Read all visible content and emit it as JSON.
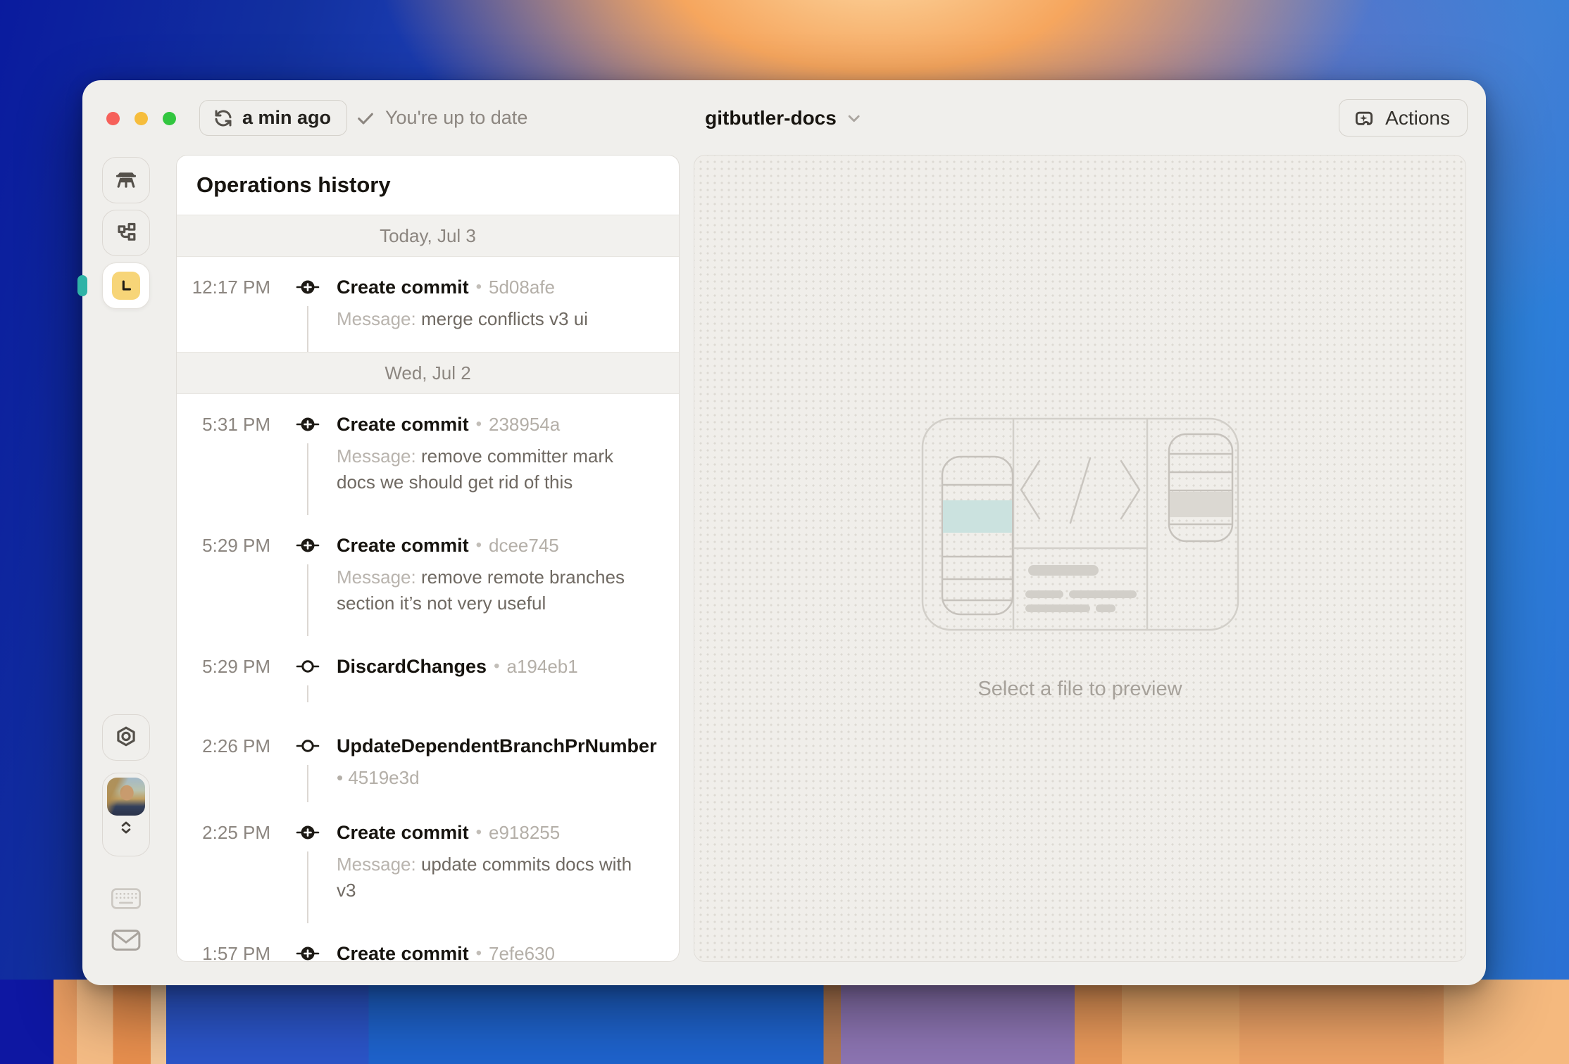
{
  "colors": {
    "accent_teal": "#2fb3a7",
    "lane_yellow": "#f7d578",
    "window_bg": "#f0efec",
    "panel_bg": "#ffffff",
    "section_bg": "#f2f1ee",
    "text_primary": "#17140f",
    "text_secondary": "#8c8680",
    "text_muted": "#b4afa8",
    "illustration_highlight_teal": "#cbe2df",
    "illustration_highlight_gray": "#dbd8d2"
  },
  "titlebar": {
    "window_controls": [
      "close",
      "minimize",
      "zoom"
    ],
    "sync_label": "a min ago",
    "status_text": "You're up to date",
    "project_name": "gitbutler-docs",
    "actions_label": "Actions"
  },
  "rail": {
    "items": [
      {
        "name": "workspace",
        "icon": "workbench-icon"
      },
      {
        "name": "branches",
        "icon": "branches-icon"
      },
      {
        "name": "history",
        "icon": "lane-l-icon",
        "active": true
      }
    ],
    "bottom": [
      {
        "name": "settings",
        "icon": "gear-icon"
      },
      {
        "name": "account",
        "icon": "avatar-photo"
      },
      {
        "name": "shortcuts",
        "icon": "keyboard-icon"
      },
      {
        "name": "feedback",
        "icon": "mail-icon"
      }
    ]
  },
  "ops": {
    "title": "Operations history",
    "message_label": "Message:",
    "sections": [
      {
        "label": "Today, Jul 3",
        "entries": [
          {
            "time": "12:17 PM",
            "icon": "commit-plus",
            "title": "Create commit",
            "hash": "5d08afe",
            "message": "merge conflicts v3 ui"
          }
        ]
      },
      {
        "label": "Wed, Jul 2",
        "entries": [
          {
            "time": "5:31 PM",
            "icon": "commit-plus",
            "title": "Create commit",
            "hash": "238954a",
            "message": "remove committer mark docs we should get rid of this"
          },
          {
            "time": "5:29 PM",
            "icon": "commit-plus",
            "title": "Create commit",
            "hash": "dcee745",
            "message": "remove remote branches section it’s not very useful"
          },
          {
            "time": "5:29 PM",
            "icon": "commit",
            "title": "DiscardChanges",
            "hash": "a194eb1",
            "stub": true
          },
          {
            "time": "2:26 PM",
            "icon": "commit",
            "title": "UpdateDependentBranchPrNumber",
            "hash_below": "4519e3d"
          },
          {
            "time": "2:25 PM",
            "icon": "commit-plus",
            "title": "Create commit",
            "hash": "e918255",
            "message": "update commits docs with v3"
          },
          {
            "time": "1:57 PM",
            "icon": "commit-plus",
            "title": "Create commit",
            "hash": "7efe630"
          }
        ]
      }
    ]
  },
  "preview": {
    "hint": "Select a file to preview"
  }
}
